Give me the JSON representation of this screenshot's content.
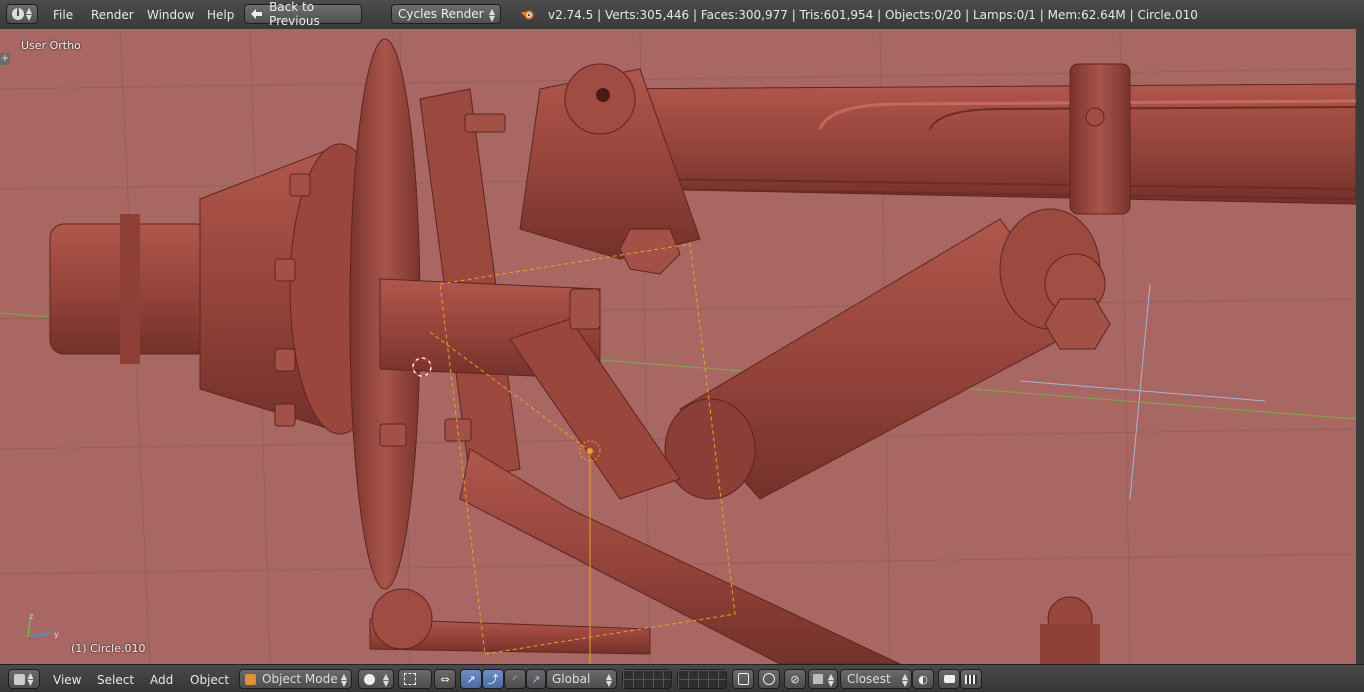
{
  "topbar": {
    "menus": [
      "File",
      "Render",
      "Window",
      "Help"
    ],
    "back_label": "Back to Previous",
    "render_engine": "Cycles Render",
    "info": "v2.74.5 | Verts:305,446 | Faces:300,977 | Tris:601,954 | Objects:0/20 | Lamps:0/1 | Mem:62.64M | Circle.010"
  },
  "viewport": {
    "view_name": "User Ortho",
    "object_label": "(1) Circle.010"
  },
  "bottombar": {
    "menus": [
      "View",
      "Select",
      "Add",
      "Object"
    ],
    "mode": "Object Mode",
    "orientation": "Global",
    "snap": "Closest"
  },
  "colors": {
    "viewport_bg": "#a86762",
    "model": "#9a4a40",
    "selection": "#f0a020",
    "grid": "#8e5d58"
  }
}
